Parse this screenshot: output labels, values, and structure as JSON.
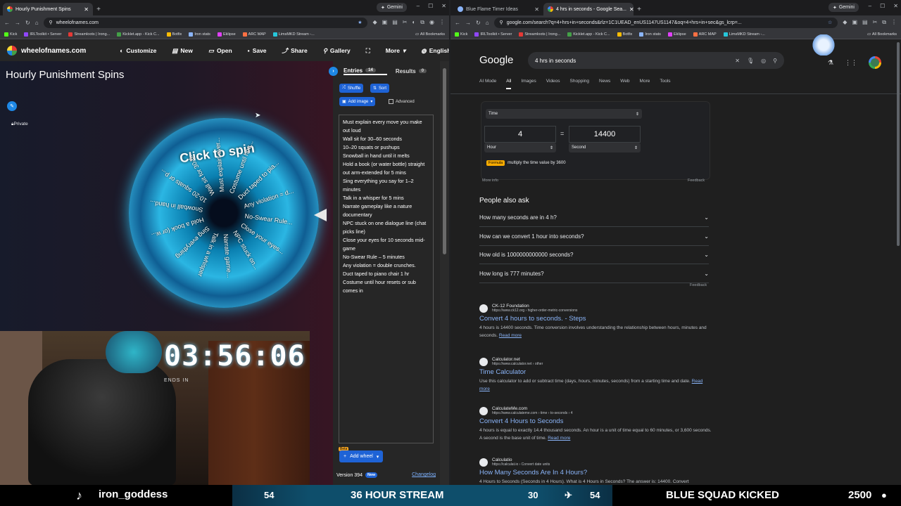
{
  "left_window": {
    "tabs": [
      {
        "label": "Hourly Punishment Spins",
        "active": true
      }
    ],
    "gemini": "Gemini",
    "url": "wheelofnames.com",
    "bookmarks": [
      "Kick",
      "IRLToolkit • Server",
      "Streamloots | Irong...",
      "Kicklet.app - Kick C...",
      "Botfix",
      "Iron stats",
      "Eklipse",
      "ARC MAP",
      "LimsMKD Stream -..."
    ],
    "all_bookmarks": "All Bookmarks"
  },
  "wheel_app": {
    "logo": "wheelofnames.com",
    "nav": [
      "Customize",
      "New",
      "Open",
      "Save",
      "Share",
      "Gallery"
    ],
    "more": "More",
    "language": "English",
    "title": "Hourly Punishment Spins",
    "private": "Private",
    "click_to_spin": "Click to spin",
    "wheel_labels": [
      "Must explain ever...",
      "Costume until hou...",
      "Duct taped to pia...",
      "Any violation = d...",
      "No-Swear Rule...",
      "Close your eyes...",
      "NPC stuck on...",
      "Narrate game...",
      "Talk in a whisper",
      "Sing everything",
      "Hold a book (or w...",
      "Snowball in hand...",
      "10-20 squats or p...",
      "Wall sit for 30-6..."
    ],
    "entries_tab": "Entries",
    "entries_count": "14",
    "results_tab": "Results",
    "results_count": "0",
    "shuffle": "Shuffle",
    "sort": "Sort",
    "add_image": "Add image",
    "advanced": "Advanced",
    "entries": [
      "Must explain every move you make out loud",
      "Wall sit for 30–60 seconds",
      "10–20 squats or pushups",
      "Snowball in hand until it melts",
      "Hold a book (or water bottle) straight out arm-extended for 5 mins",
      "Sing everything you say for 1–2 minutes",
      "Talk in a whisper for 5 mins",
      "Narrate gameplay like a nature documentary",
      "NPC stuck on one dialogue line (chat picks line)",
      "Close your eyes for 10 seconds mid-game",
      "No-Swear Rule – 5 minutes",
      "Any violation = double crunches.",
      "Duct taped to piano chair 1 hr",
      "Costume until hour resets or sub comes in"
    ],
    "beta": "Beta",
    "add_wheel": "Add wheel",
    "version": "Version 394",
    "new_badge": "New",
    "changelog": "Changelog"
  },
  "stream_overlay": {
    "timer": "03:56:06",
    "ends_in": "ENDS IN",
    "username": "iron_goddess",
    "ticker_left_num": "54",
    "ticker_center": "36 HOUR STREAM",
    "ticker_right_num": "30",
    "ticker_num2": "54",
    "squad_text": "BLUE SQUAD KICKED",
    "squad_count": "2500"
  },
  "right_window": {
    "tabs": [
      {
        "label": "Blue Flame Timer Ideas",
        "active": false
      },
      {
        "label": "4 hrs in seconds - Google Sea...",
        "active": true
      }
    ],
    "gemini": "Gemini",
    "url": "google.com/search?q=4+hrs+in+seconds&rlz=1C1UEAD_enUS1147US1147&oq=4+hrs+in+sec&gs_lcrp=...",
    "bookmarks": [
      "Kick",
      "IRLToolkit • Server",
      "Streamloots | Irong...",
      "Kicklet.app - Kick C...",
      "Botfix",
      "Iron stats",
      "Eklipse",
      "ARC MAP",
      "LimsMKD Stream -..."
    ],
    "all_bookmarks": "All Bookmarks"
  },
  "google": {
    "logo": "Google",
    "query": "4 hrs in seconds",
    "tabs": [
      "AI Mode",
      "All",
      "Images",
      "Videos",
      "Shopping",
      "News",
      "Web",
      "More",
      "Tools"
    ],
    "converter": {
      "category": "Time",
      "from_value": "4",
      "equals": "=",
      "to_value": "14400",
      "from_unit": "Hour",
      "to_unit": "Second",
      "formula_label": "Formula",
      "formula": "multiply the time value by 3600",
      "more_info": "More info",
      "feedback": "Feedback"
    },
    "paa_title": "People also ask",
    "questions": [
      "How many seconds are in 4 h?",
      "How can we convert 1 hour into seconds?",
      "How old is 1000000000000 seconds?",
      "How long is 777 minutes?"
    ],
    "feedback2": "Feedback",
    "results": [
      {
        "site": "CK-12 Foundation",
        "url": "https://www.ck12.org › higher-order-metric-conversions",
        "title": "Convert 4 hours to seconds. - Steps",
        "snippet": "4 hours is 14400 seconds. Time conversion involves understanding the relationship between hours, minutes and seconds.",
        "more": "Read more"
      },
      {
        "site": "Calculator.net",
        "url": "https://www.calculator.net › other",
        "title": "Time Calculator",
        "snippet": "Use this calculator to add or subtract time (days, hours, minutes, seconds) from a starting time and date.",
        "more": "Read more"
      },
      {
        "site": "CalculateMe.com",
        "url": "https://www.calculateme.com › time › to-seconds › 4",
        "title": "Convert 4 Hours to Seconds",
        "snippet": "4 hours is equal to exactly 14.4 thousand seconds. An hour is a unit of time equal to 60 minutes, or 3,600 seconds. A second is the base unit of time.",
        "more": "Read more"
      },
      {
        "site": "Calculatio",
        "url": "https://calculat.io › Convert date units",
        "title": "How Many Seconds Are In 4 Hours?",
        "snippet": "4 Hours to Seconds (Seconds in 4 Hours). What is 4 Hours in Seconds? The answer is: 14400. Convert",
        "more": ""
      }
    ]
  },
  "colors": {
    "wheel_blue": "#2bb6e3",
    "accent": "#1e63d6",
    "link": "#8ab4f8"
  }
}
